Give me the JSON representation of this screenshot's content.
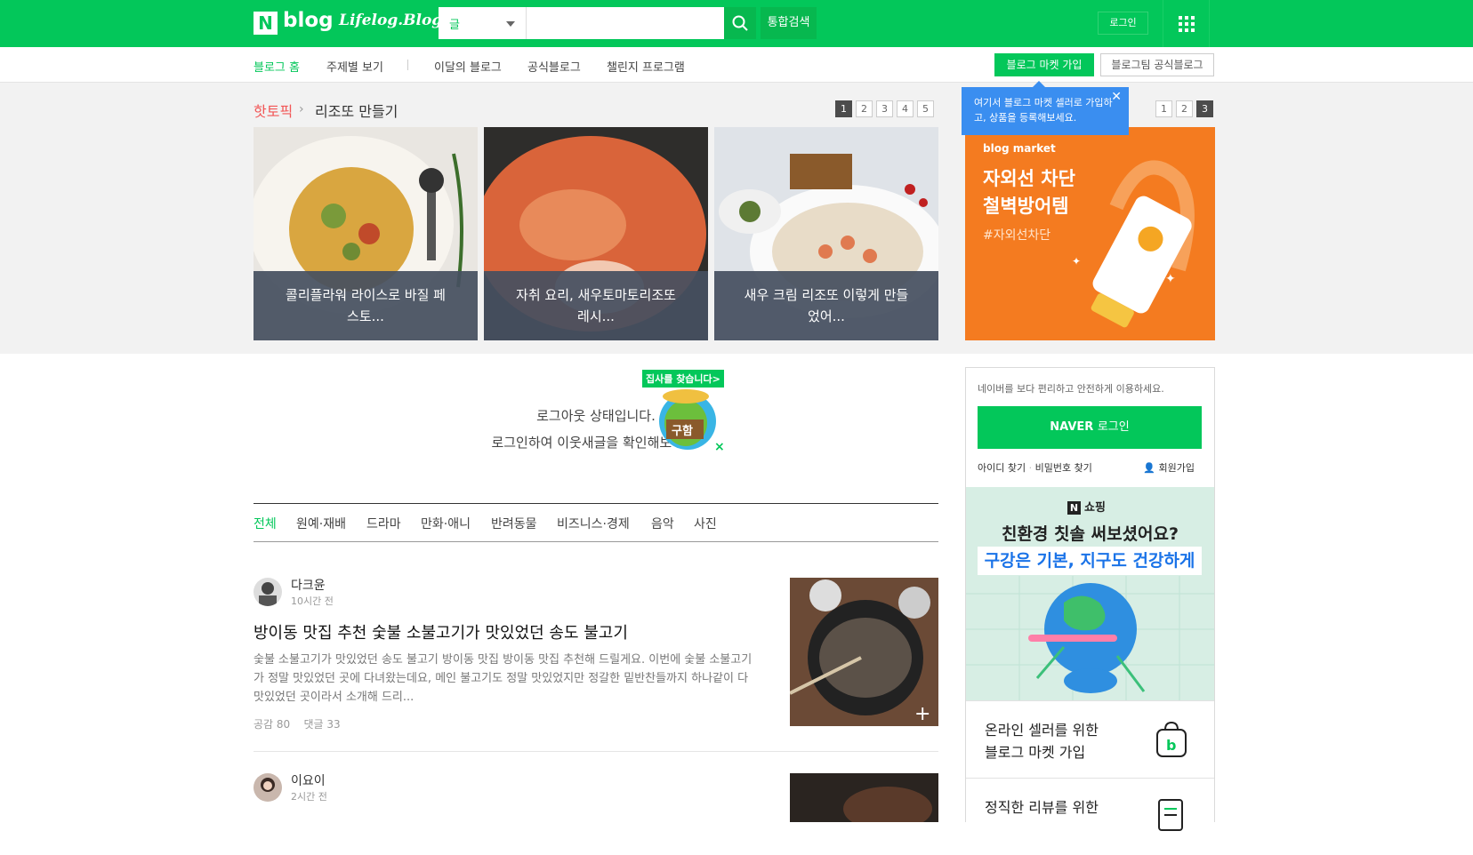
{
  "header": {
    "logo_n": "N",
    "logo_blog": "blog",
    "logo_lifelog": "Lifelog.Blog",
    "search_select": "글",
    "search_value": "",
    "total_search": "통합검색",
    "login": "로그인"
  },
  "nav": {
    "items": [
      "블로그 홈",
      "주제별 보기",
      "이달의 블로그",
      "공식블로그",
      "챌린지 프로그램"
    ],
    "market_join": "블로그 마켓 가입",
    "official_blog": "블로그팀 공식블로그"
  },
  "hot": {
    "label": "핫토픽",
    "topic": "리조또 만들기",
    "pages": [
      "1",
      "2",
      "3",
      "4",
      "5"
    ],
    "active_page": "1",
    "cards": [
      {
        "caption": "콜리플라워 라이스로 바질 페스토..."
      },
      {
        "caption": "자취 요리, 새우토마토리조또 레시..."
      },
      {
        "caption": "새우 크림 리조또 이렇게 만들었어..."
      }
    ]
  },
  "tooltip": {
    "text": "여기서 블로그 마켓 셀러로 가입하고, 상품을 등록해보세요."
  },
  "ad": {
    "pages": [
      "1",
      "2",
      "3"
    ],
    "active_page": "3",
    "brand": "blog market",
    "headline1": "자외선 차단",
    "headline2": "철벽방어템",
    "hashtag": "#자외선차단"
  },
  "login_msg": {
    "line1": "로그아웃 상태입니다.",
    "line2": "로그인하여 이웃새글을 확인해보세요.",
    "char_tag": "집사를 찾습니다>",
    "char_sign": "구함"
  },
  "categories": [
    "전체",
    "원예·재배",
    "드라마",
    "만화·애니",
    "반려동물",
    "비즈니스·경제",
    "음악",
    "사진"
  ],
  "posts": [
    {
      "author": "다크윤",
      "time": "10시간 전",
      "title": "방이동 맛집 추천 숯불 소불고기가 맛있었던 송도 불고기",
      "body": "숯불 소불고기가 맛있었던 송도 불고기 방이동 맛집 방이동 맛집 추천해 드릴게요. 이번에 숯불 소불고기가 정말 맛있었던 곳에 다녀왔는데요, 메인 불고기도 정말 맛있었지만 정갈한 밑반찬들까지 하나같이 다 맛있었던 곳이라서 소개해 드리...",
      "likes": "공감 80",
      "comments": "댓글 33"
    },
    {
      "author": "이요이",
      "time": "2시간 전"
    }
  ],
  "side": {
    "intro": "네이버를 보다 편리하고 안전하게 이용하세요.",
    "naver_login_brand": "NAVER",
    "naver_login": "로그인",
    "find_id": "아이디 찾기",
    "find_pw": "비밀번호 찾기",
    "join": "회원가입",
    "shop_label": "쇼핑",
    "shop_h1": "친환경 칫솔 써보셨어요?",
    "shop_h2": "구강은 기본, 지구도 건강하게",
    "promo1_l1": "온라인 셀러를 위한",
    "promo1_l2": "블로그 마켓 가입",
    "promo2_l1": "정직한 리뷰를 위한"
  },
  "colors": {
    "brand_green": "#03c75a",
    "hot_red": "#f25656",
    "tooltip_blue": "#3a8ef0",
    "ad_orange": "#f47b20"
  }
}
